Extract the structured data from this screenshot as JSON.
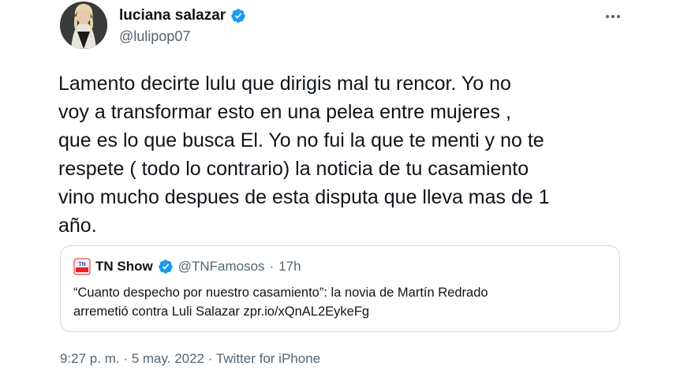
{
  "author": {
    "display_name": "luciana salazar",
    "handle": "@lulipop07",
    "verified": true,
    "avatar": "avatar-photo"
  },
  "menu": {
    "icon": "more-horizontal-icon"
  },
  "tweet": {
    "lines": [
      "Lamento decirte lulu que dirigis mal tu rencor. Yo no",
      "voy a transformar esto en una pelea entre mujeres ,",
      "que es lo que busca El. Yo no fui la que te menti y no te",
      "respete ( todo lo contrario) la noticia de tu casamiento",
      "vino mucho despues de esta disputa que lleva mas de 1",
      "año."
    ]
  },
  "quote": {
    "logo_icon": "tn-show-logo",
    "display_name": "TN Show",
    "verified": true,
    "handle": "@TNFamosos",
    "separator": "·",
    "time": "17h",
    "lines": [
      "“Cuanto despecho por nuestro casamiento”: la novia de Martín Redrado",
      "arremetió contra Luli Salazar zpr.io/xQnAL2EykeFg"
    ]
  },
  "meta": {
    "time": "9:27 p. m.",
    "separator1": " · ",
    "date": "5 may. 2022",
    "separator2": " · ",
    "source": "Twitter for iPhone"
  },
  "colors": {
    "verified_blue": "#1d9bf0",
    "secondary_text": "#536471",
    "border": "#cfd9de",
    "tn_red": "#e3242b"
  }
}
